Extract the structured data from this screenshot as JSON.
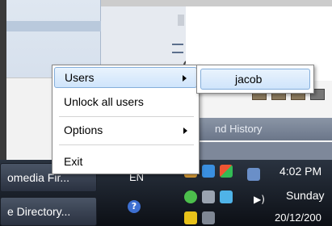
{
  "background": {
    "history_label": "nd History"
  },
  "taskbar": {
    "buttons": [
      {
        "label": "omedia Fir..."
      },
      {
        "label": "e Directory..."
      }
    ],
    "language": "EN",
    "help_glyph": "?",
    "clock": {
      "time": "4:02 PM",
      "day": "Sunday",
      "date": "20/12/200"
    }
  },
  "menu": {
    "items": [
      {
        "label": "Users"
      },
      {
        "label": "Unlock all users"
      },
      {
        "label": "Options"
      },
      {
        "label": "Exit"
      }
    ]
  },
  "submenu": {
    "items": [
      {
        "label": "jacob"
      }
    ]
  }
}
